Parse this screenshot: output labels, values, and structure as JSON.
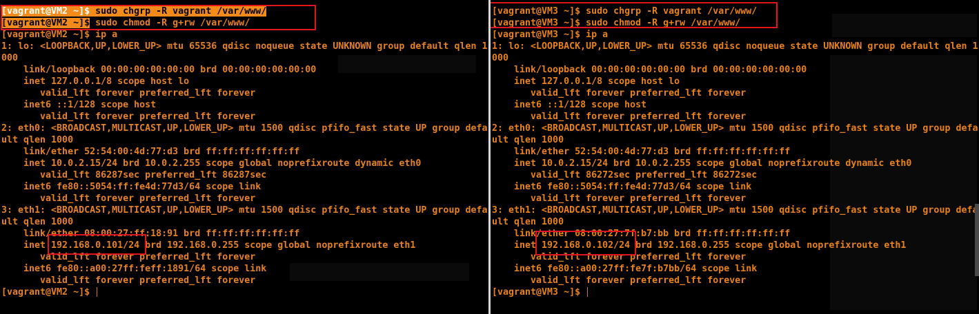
{
  "colors": {
    "text": "#e8821e",
    "selection": "#f38b1a",
    "annotation": "#e0161c",
    "background": "#000000"
  },
  "left": {
    "lines": [
      "[vagrant@VM2 ~]$ sudo chgrp -R vagrant /var/www/",
      "[vagrant@VM2 ~]$ sudo chmod -R g+rw /var/www/",
      "[vagrant@VM2 ~]$ ip a",
      "1: lo: <LOOPBACK,UP,LOWER_UP> mtu 65536 qdisc noqueue state UNKNOWN group default qlen 1",
      "000",
      "    link/loopback 00:00:00:00:00:00 brd 00:00:00:00:00:00",
      "    inet 127.0.0.1/8 scope host lo",
      "       valid_lft forever preferred_lft forever",
      "    inet6 ::1/128 scope host",
      "       valid_lft forever preferred_lft forever",
      "2: eth0: <BROADCAST,MULTICAST,UP,LOWER_UP> mtu 1500 qdisc pfifo_fast state UP group defa",
      "ult qlen 1000",
      "    link/ether 52:54:00:4d:77:d3 brd ff:ff:ff:ff:ff:ff",
      "    inet 10.0.2.15/24 brd 10.0.2.255 scope global noprefixroute dynamic eth0",
      "       valid_lft 86287sec preferred_lft 86287sec",
      "    inet6 fe80::5054:ff:fe4d:77d3/64 scope link",
      "       valid_lft forever preferred_lft forever",
      "3: eth1: <BROADCAST,MULTICAST,UP,LOWER_UP> mtu 1500 qdisc pfifo_fast state UP group defa",
      "ult qlen 1000",
      "    link/ether 08:00:27:ff:18:91 brd ff:ff:ff:ff:ff:ff",
      "    inet 192.168.0.101/24 brd 192.168.0.255 scope global noprefixroute eth1",
      "       valid_lft forever preferred_lft forever",
      "    inet6 fe80::a00:27ff:feff:1891/64 scope link",
      "       valid_lft forever preferred_lft forever"
    ],
    "prompt": "[vagrant@VM2 ~]$ ",
    "prompt_label": "[vagrant@VM2 ~]$",
    "cmd1_prompt": "[vagrant@VM2 ~]$",
    "cmd1_text": " sudo chgrp -R vagrant /var/www/",
    "cmd2_prompt": "[vagrant@VM2 ~]$",
    "cmd2_text": " sudo chmod -R g+rw /var/www/"
  },
  "right": {
    "lines": [
      "[vagrant@VM3 ~]$ sudo chgrp -R vagrant /var/www/",
      "[vagrant@VM3 ~]$ sudo chmod -R g+rw /var/www/",
      "[vagrant@VM3 ~]$ ip a",
      "1: lo: <LOOPBACK,UP,LOWER_UP> mtu 65536 qdisc noqueue state UNKNOWN group default qlen 1",
      "000",
      "    link/loopback 00:00:00:00:00:00 brd 00:00:00:00:00:00",
      "    inet 127.0.0.1/8 scope host lo",
      "       valid_lft forever preferred_lft forever",
      "    inet6 ::1/128 scope host",
      "       valid_lft forever preferred_lft forever",
      "2: eth0: <BROADCAST,MULTICAST,UP,LOWER_UP> mtu 1500 qdisc pfifo_fast state UP group defa",
      "ult qlen 1000",
      "    link/ether 52:54:00:4d:77:d3 brd ff:ff:ff:ff:ff:ff",
      "    inet 10.0.2.15/24 brd 10.0.2.255 scope global noprefixroute dynamic eth0",
      "       valid_lft 86272sec preferred_lft 86272sec",
      "    inet6 fe80::5054:ff:fe4d:77d3/64 scope link",
      "       valid_lft forever preferred_lft forever",
      "3: eth1: <BROADCAST,MULTICAST,UP,LOWER_UP> mtu 1500 qdisc pfifo_fast state UP group defa",
      "ult qlen 1000",
      "    link/ether 08:00:27:7f:b7:bb brd ff:ff:ff:ff:ff:ff",
      "    inet 192.168.0.102/24 brd 192.168.0.255 scope global noprefixroute eth1",
      "       valid_lft forever preferred_lft forever",
      "    inet6 fe80::a00:27ff:fe7f:b7bb/64 scope link",
      "       valid_lft forever preferred_lft forever"
    ],
    "prompt": "[vagrant@VM3 ~]$ "
  }
}
